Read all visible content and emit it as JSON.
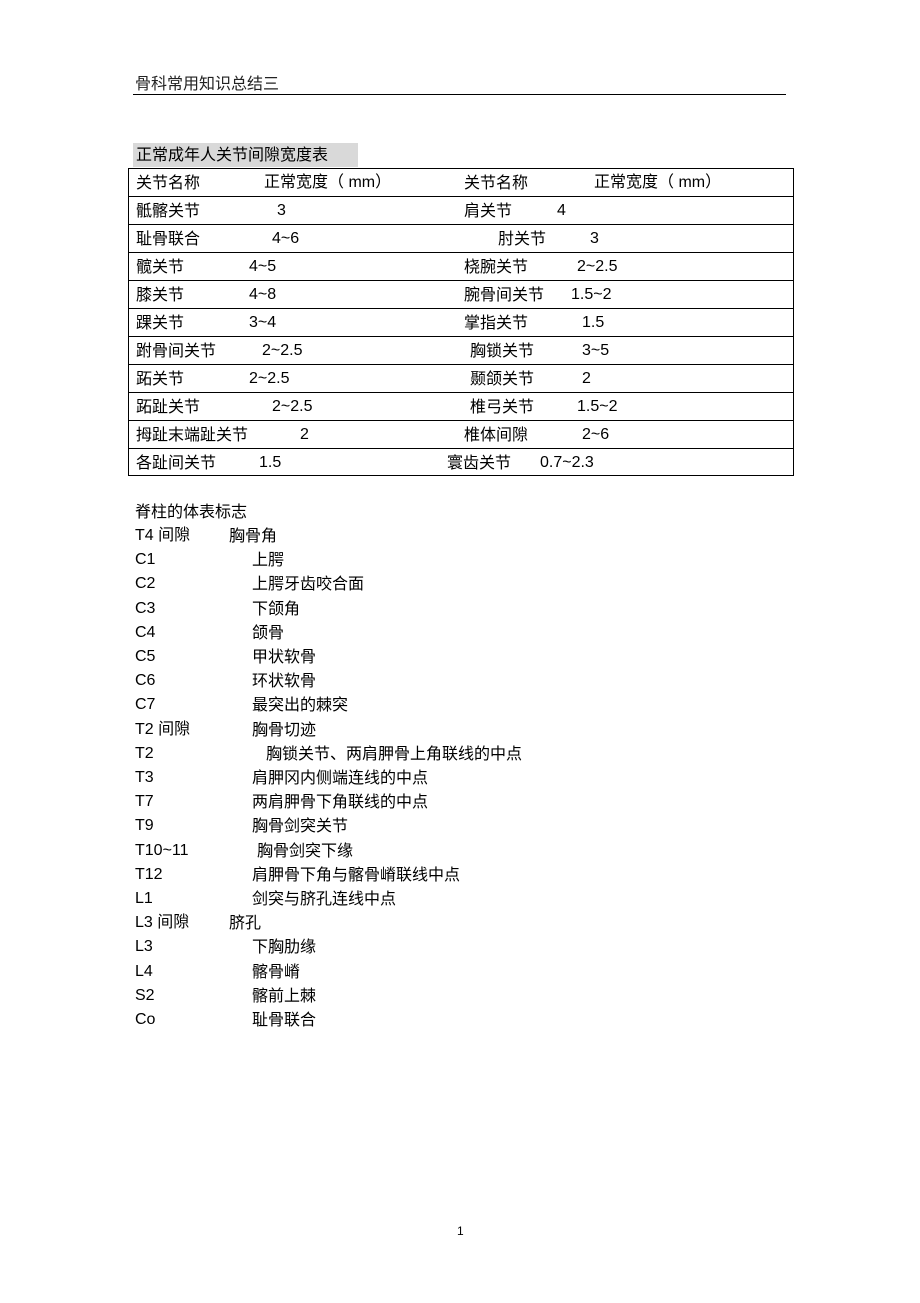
{
  "header": {
    "title": "骨科常用知识总结三"
  },
  "table": {
    "title": "正常成年人关节间隙宽度表",
    "headers": [
      "关节名称",
      "正常宽度（ mm）",
      "关节名称",
      "正常宽度（ mm）"
    ],
    "rows": [
      [
        "骶髂关节",
        "3",
        "肩关节",
        "4"
      ],
      [
        "耻骨联合",
        "4~6",
        "肘关节",
        "3"
      ],
      [
        "髋关节",
        "4~5",
        "桡腕关节",
        "2~2.5"
      ],
      [
        "膝关节",
        "4~8",
        "腕骨间关节",
        "1.5~2"
      ],
      [
        "踝关节",
        "3~4",
        "掌指关节",
        "1.5"
      ],
      [
        "跗骨间关节",
        "2~2.5",
        "胸锁关节",
        "3~5"
      ],
      [
        "跖关节",
        "2~2.5",
        "颞颌关节",
        "2"
      ],
      [
        "跖趾关节",
        "2~2.5",
        "椎弓关节",
        "1.5~2"
      ],
      [
        "拇趾末端趾关节",
        "2",
        "椎体间隙",
        "2~6"
      ],
      [
        "各趾间关节",
        "1.5",
        "寰齿关节",
        "0.7~2.3"
      ]
    ]
  },
  "spine": {
    "title": "脊柱的体表标志",
    "items": [
      [
        "T4 间隙",
        "胸骨角"
      ],
      [
        "C1",
        "上腭"
      ],
      [
        "C2",
        "上腭牙齿咬合面"
      ],
      [
        "C3",
        "下颌角"
      ],
      [
        "C4",
        "颌骨"
      ],
      [
        "C5",
        "甲状软骨"
      ],
      [
        "C6",
        "环状软骨"
      ],
      [
        "C7",
        "最突出的棘突"
      ],
      [
        "T2 间隙",
        "胸骨切迹"
      ],
      [
        "T2",
        "胸锁关节、两肩胛骨上角联线的中点"
      ],
      [
        "T3",
        "肩胛冈内侧端连线的中点"
      ],
      [
        "T7",
        "两肩胛骨下角联线的中点"
      ],
      [
        "T9",
        "胸骨剑突关节"
      ],
      [
        "T10~11",
        "胸骨剑突下缘"
      ],
      [
        "T12",
        "肩胛骨下角与髂骨嵴联线中点"
      ],
      [
        "L1",
        "剑突与脐孔连线中点"
      ],
      [
        "L3 间隙",
        "脐孔"
      ],
      [
        "L3",
        "下胸肋缘"
      ],
      [
        "L4",
        "髂骨嵴"
      ],
      [
        "S2",
        "髂前上棘"
      ],
      [
        "Co",
        "耻骨联合"
      ]
    ]
  },
  "footer": {
    "page_number": "1"
  }
}
